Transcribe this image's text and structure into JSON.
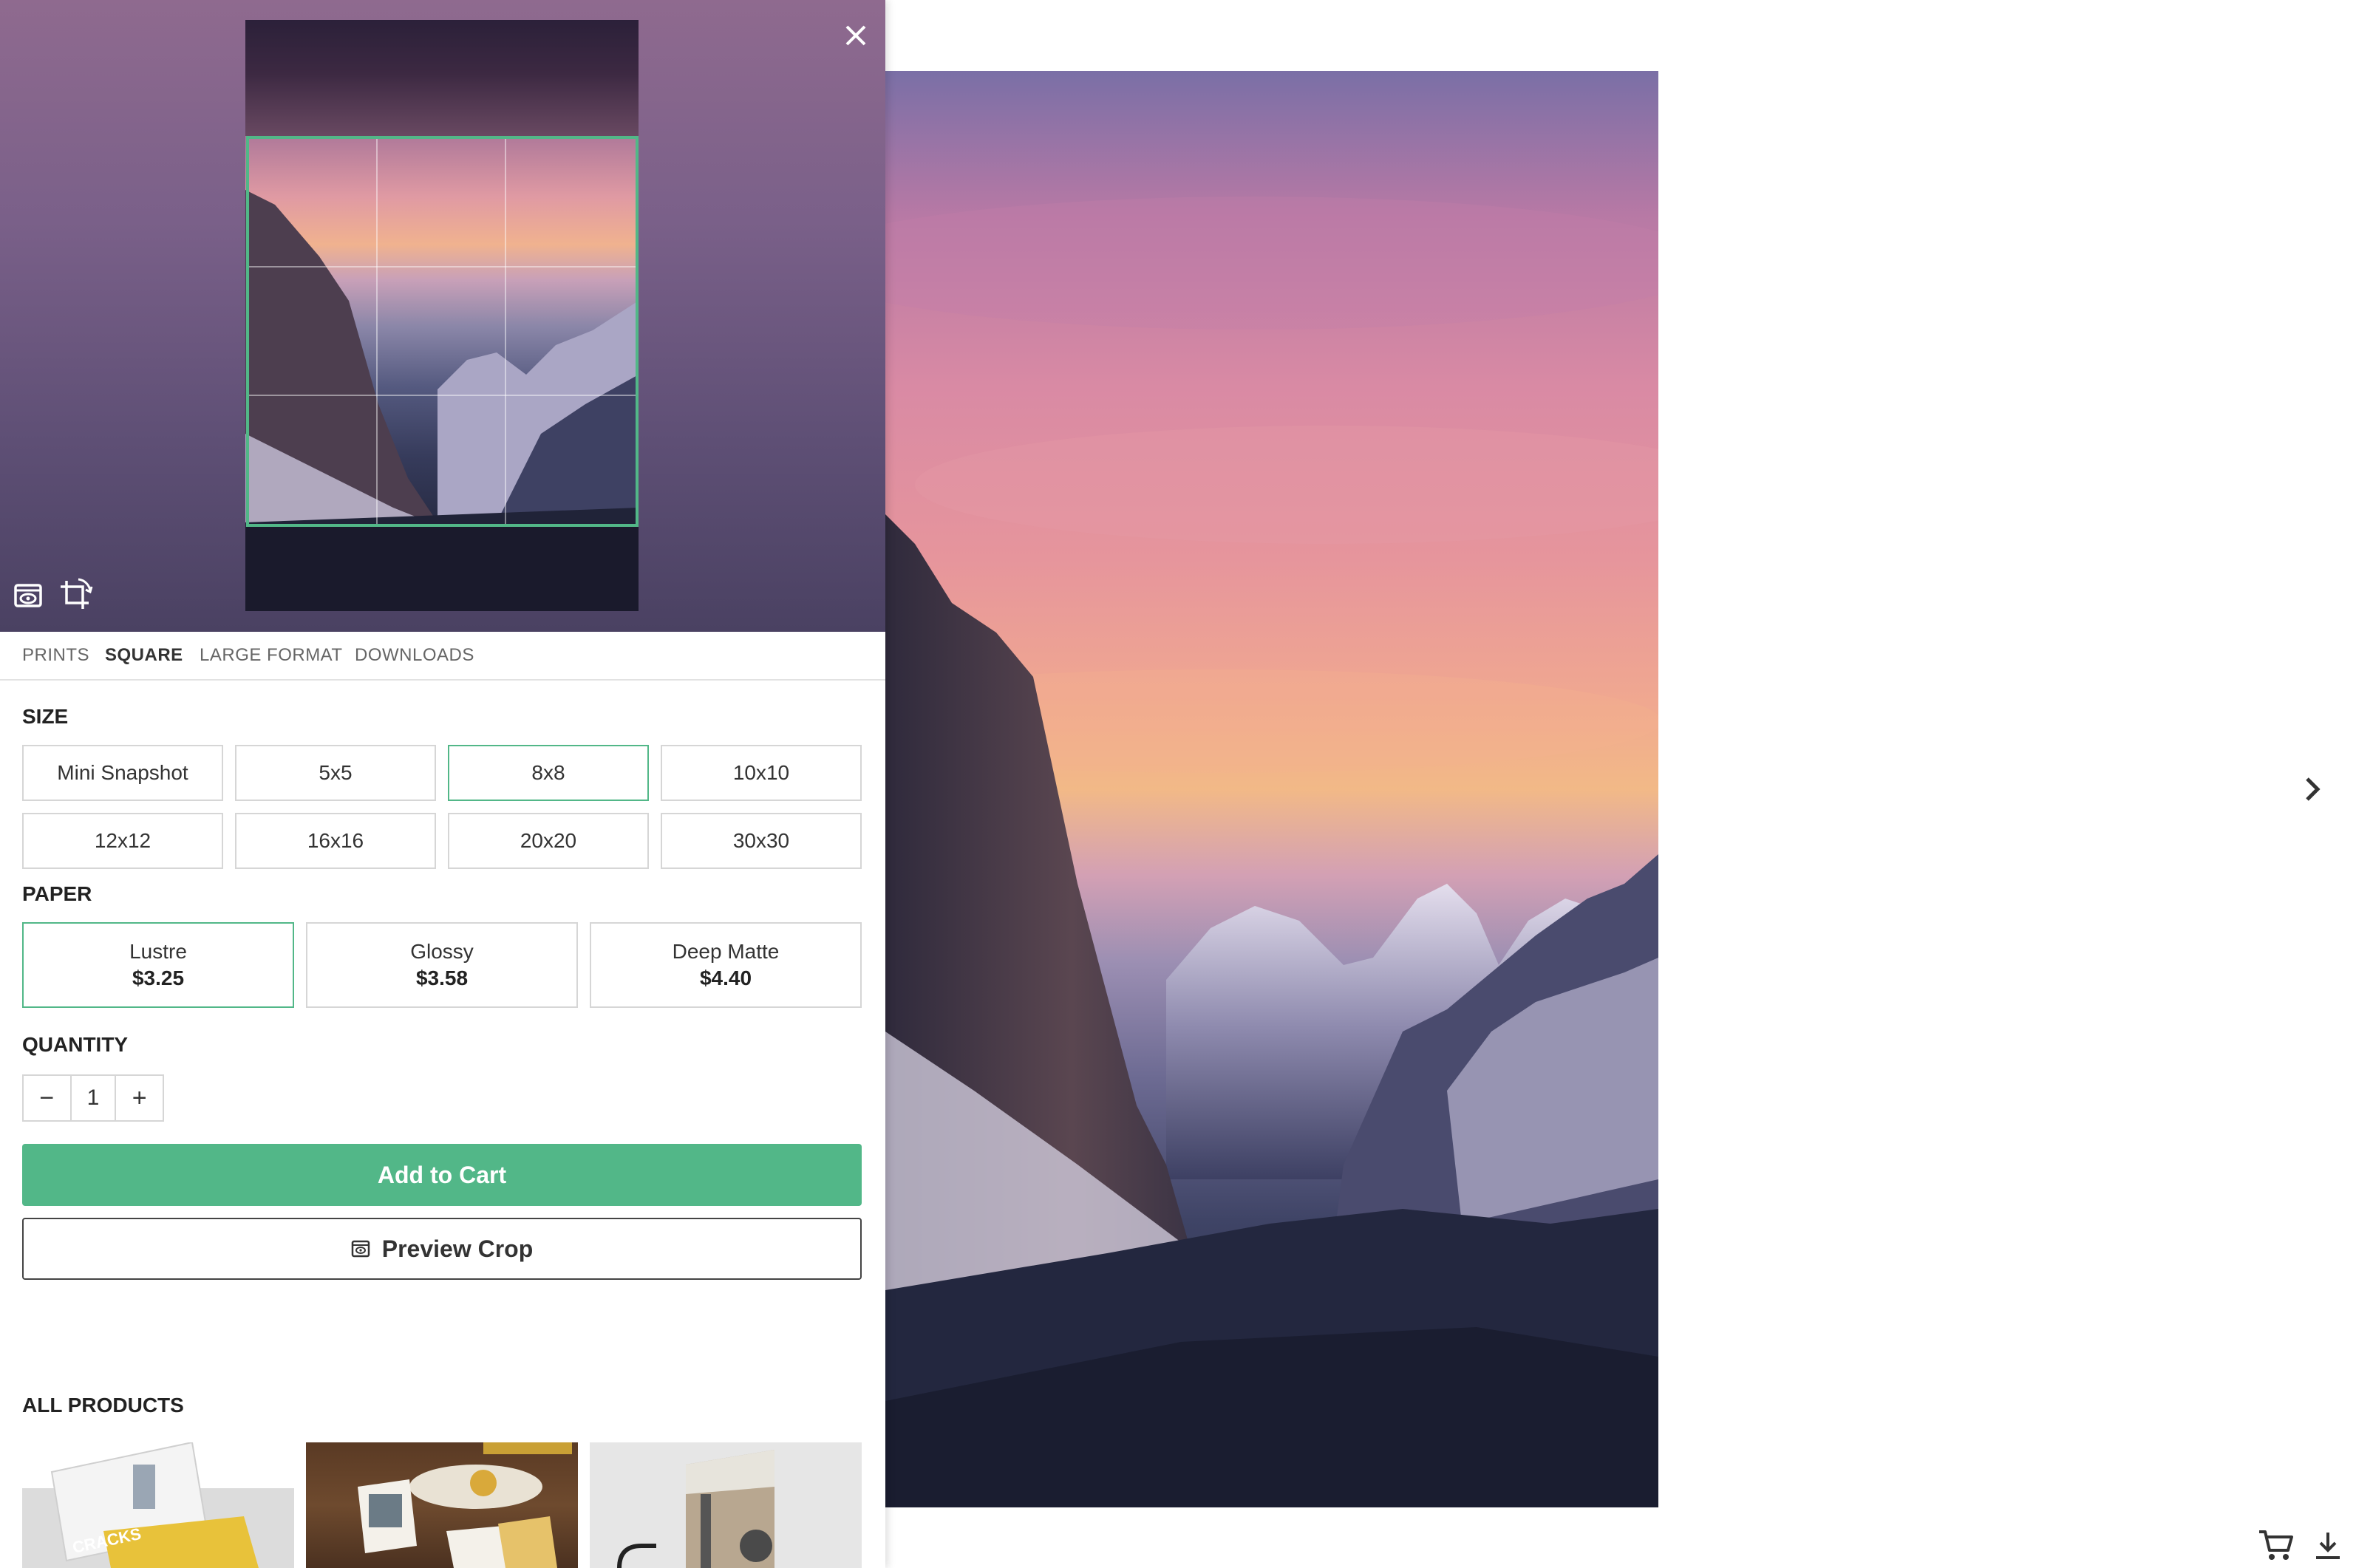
{
  "colors": {
    "accent": "#52b788",
    "text": "#333333",
    "border": "#d6d6d6"
  },
  "tabs": [
    {
      "label": "PRINTS",
      "active": false
    },
    {
      "label": "SQUARE",
      "active": true
    },
    {
      "label": "LARGE FORMAT",
      "active": false
    },
    {
      "label": "DOWNLOADS",
      "active": false
    }
  ],
  "size": {
    "title": "SIZE",
    "selected": "8x8",
    "options": [
      "Mini Snapshot",
      "5x5",
      "8x8",
      "10x10",
      "12x12",
      "16x16",
      "20x20",
      "30x30"
    ]
  },
  "paper": {
    "title": "PAPER",
    "selected": "Lustre",
    "options": [
      {
        "name": "Lustre",
        "price": "$3.25"
      },
      {
        "name": "Glossy",
        "price": "$3.58"
      },
      {
        "name": "Deep Matte",
        "price": "$4.40"
      }
    ]
  },
  "quantity": {
    "title": "QUANTITY",
    "value": "1",
    "decrement": "−",
    "increment": "+"
  },
  "actions": {
    "add_to_cart": "Add to Cart",
    "preview_crop": "Preview Crop"
  },
  "products": {
    "title": "ALL PRODUCTS",
    "card_text": "CRACKS"
  },
  "icons": {
    "close": "close-icon",
    "preview": "eye-icon",
    "rotate_crop": "rotate-crop-icon",
    "next": "chevron-right-icon",
    "cart": "cart-icon",
    "download": "download-icon"
  }
}
